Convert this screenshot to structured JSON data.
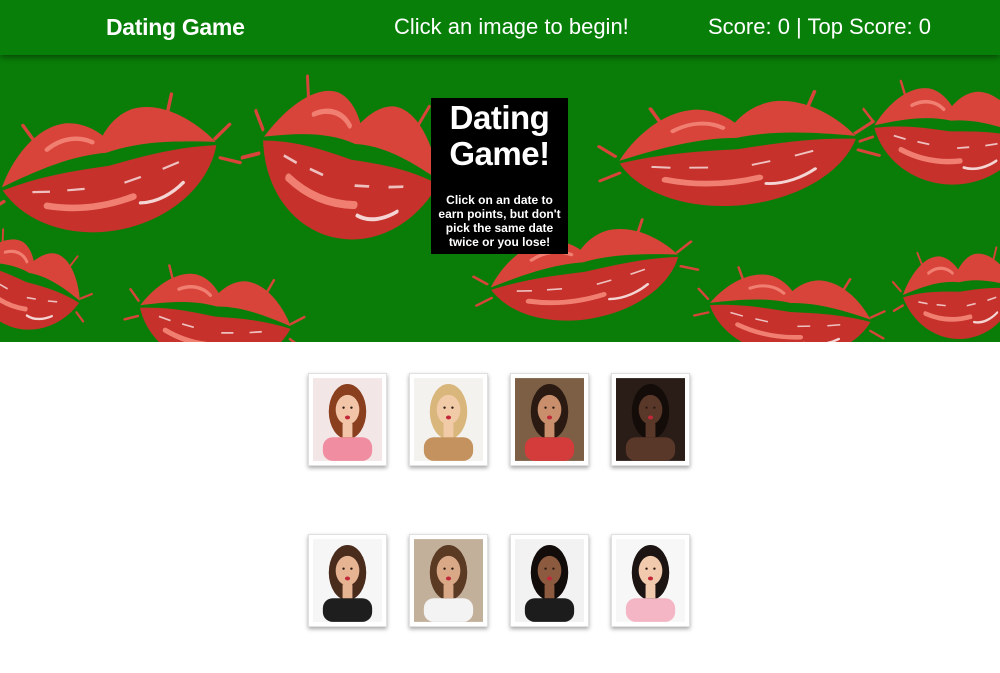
{
  "navbar": {
    "brand": "Dating Game",
    "message": "Click an image to begin!",
    "score": "Score: 0 | Top Score: 0"
  },
  "hero": {
    "title_line1": "Dating",
    "title_line2": "Game!",
    "instructions": "Click on an date to earn points, but don't pick the same date twice or you lose!"
  },
  "cards": [
    {
      "bg": "#f3e6e6",
      "hair": "#8a3f1f",
      "skin": "#f2c5a8",
      "top": "#f08da0"
    },
    {
      "bg": "#f4f2ef",
      "hair": "#d9b67b",
      "skin": "#f1cba8",
      "top": "#c4925e"
    },
    {
      "bg": "#7c5f44",
      "hair": "#2b1a12",
      "skin": "#c98f6d",
      "top": "#d43b3b"
    },
    {
      "bg": "#2a1d18",
      "hair": "#140c09",
      "skin": "#5a3829",
      "top": "#5a3829"
    },
    {
      "bg": "#f6f6f6",
      "hair": "#4a2c1d",
      "skin": "#e6b493",
      "top": "#1e1e1e"
    },
    {
      "bg": "#c3b09b",
      "hair": "#5b3a24",
      "skin": "#d9a887",
      "top": "#f3f3f3"
    },
    {
      "bg": "#f2f2f2",
      "hair": "#120c0a",
      "skin": "#8b5a3f",
      "top": "#1c1c1c"
    },
    {
      "bg": "#f7f7f7",
      "hair": "#1c1412",
      "skin": "#f1c9ac",
      "top": "#f4b6c4"
    }
  ],
  "colors": {
    "navbar": "#087f08",
    "hero_bg": "#0a7d08",
    "lips": "#d9443a",
    "lips_dark": "#b8231f"
  }
}
